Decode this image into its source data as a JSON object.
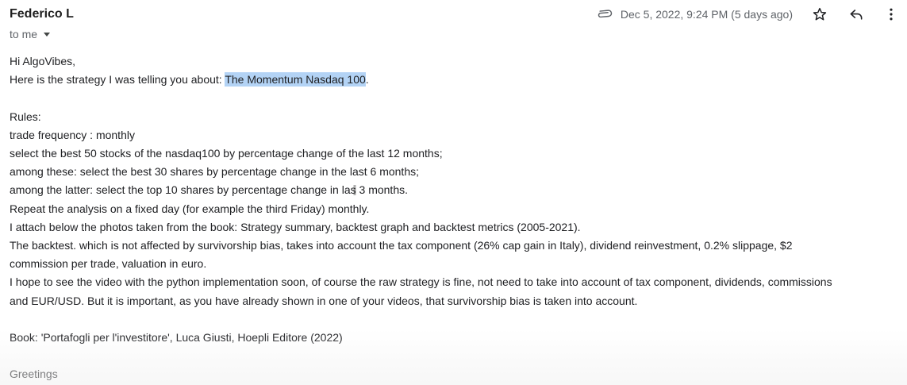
{
  "message": {
    "sender_name": "Federico L",
    "recipient_label": "to me",
    "date_text": "Dec 5, 2022, 9:24 PM (5 days ago)",
    "icons": {
      "attachment": "paperclip-icon",
      "star": "star-outline-icon",
      "reply": "reply-icon",
      "more": "more-vert-icon",
      "recipient_dropdown": "caret-down-icon"
    }
  },
  "body": {
    "greeting": "Hi AlgoVibes,",
    "intro_prefix": "Here is the strategy I was telling you about: ",
    "intro_highlight": "The Momentum Nasdaq 100",
    "intro_suffix": ".",
    "rules_heading": "Rules:",
    "rule_frequency": "trade frequency : monthly",
    "rule_step1": "select the best 50 stocks of the nasdaq100 by percentage change of the last 12 months;",
    "rule_step2": "among these: select the best 30 shares by percentage change in the last 6 months;",
    "rule_step3_prefix": "among the latter: select the top 10 shares by percentage change in las",
    "rule_step3_suffix": " 3 months.",
    "rule_repeat": "Repeat the analysis on a fixed day (for example the third Friday) monthly.",
    "attach_note": "I attach below the photos taken from the book: Strategy summary, backtest graph and backtest metrics (2005-2021).",
    "backtest_line1": "The backtest. which is not affected by survivorship bias, takes into account the tax component (26% cap gain in Italy), dividend reinvestment, 0.2% slippage, $2",
    "backtest_line2": "commission per trade, valuation in euro.",
    "hope_line1": "I hope to see the video with the python implementation soon, of course the raw strategy is fine, not need to take into account of tax component, dividends, commissions",
    "hope_line2": "and EUR/USD. But it is important, as you have already shown in one of your videos, that survivorship bias is taken into account.",
    "book": "Book: 'Portafogli per l'investitore', Luca Giusti, Hoepli Editore (2022)",
    "closing": "Greetings"
  },
  "colors": {
    "highlight": "#b3d3f5",
    "secondary_text": "#5f6368",
    "primary_text": "#202124"
  }
}
